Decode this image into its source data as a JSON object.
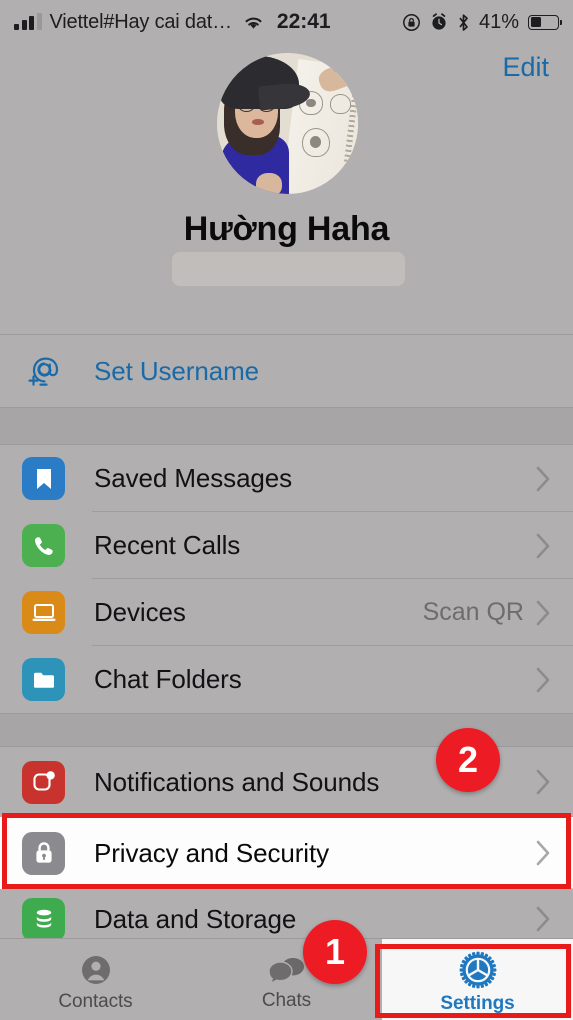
{
  "status_bar": {
    "carrier": "Viettel#Hay cai dat…",
    "wifi_icon": "wifi-icon",
    "time": "22:41",
    "rotation_lock_icon": "rotation-lock-icon",
    "alarm_icon": "alarm-clock-icon",
    "bluetooth_icon": "bluetooth-icon",
    "battery_percent": "41%",
    "battery_icon": "battery-icon"
  },
  "profile": {
    "edit_label": "Edit",
    "avatar_alt": "user-avatar-photo",
    "name": "Hường Haha",
    "phone_redacted": ""
  },
  "username_section": {
    "icon": "at-plus-icon",
    "label": "Set Username"
  },
  "sections": [
    {
      "rows": [
        {
          "icon": "bookmark-icon",
          "label": "Saved Messages",
          "value": "",
          "chevron": "›"
        },
        {
          "icon": "phone-icon",
          "label": "Recent Calls",
          "value": "",
          "chevron": "›"
        },
        {
          "icon": "laptop-icon",
          "label": "Devices",
          "value": "Scan QR",
          "chevron": "›"
        },
        {
          "icon": "folder-icon",
          "label": "Chat Folders",
          "value": "",
          "chevron": "›"
        }
      ]
    },
    {
      "rows": [
        {
          "icon": "notification-icon",
          "label": "Notifications and Sounds",
          "value": "",
          "chevron": "›"
        },
        {
          "icon": "lock-icon",
          "label": "Privacy and Security",
          "value": "",
          "chevron": "›",
          "highlighted": true
        },
        {
          "icon": "database-icon",
          "label": "Data and Storage",
          "value": "",
          "chevron": "›"
        }
      ]
    }
  ],
  "tabbar": {
    "tabs": [
      {
        "icon": "contacts-person-icon",
        "label": "Contacts",
        "active": false
      },
      {
        "icon": "chats-bubbles-icon",
        "label": "Chats",
        "active": false
      },
      {
        "icon": "settings-gear-icon",
        "label": "Settings",
        "active": true
      }
    ]
  },
  "annotations": {
    "badges": [
      {
        "label": "1",
        "name": "step-badge-1"
      },
      {
        "label": "2",
        "name": "step-badge-2"
      }
    ],
    "highlight_color": "#e81b1b",
    "badge_color": "#ed1c24"
  },
  "colors": {
    "accent_blue": "#1a6aa8",
    "tab_active_blue": "#1f78c0",
    "dim_background": "#b1afb0",
    "section_gap": "#a7a5a6"
  }
}
